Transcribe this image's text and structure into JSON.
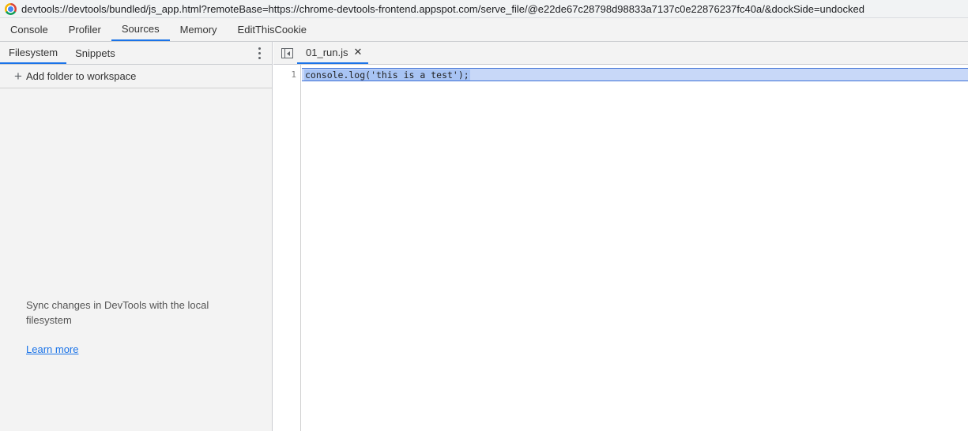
{
  "titlebar": {
    "url": "devtools://devtools/bundled/js_app.html?remoteBase=https://chrome-devtools-frontend.appspot.com/serve_file/@e22de67c28798d98833a7137c0e22876237fc40a/&dockSide=undocked"
  },
  "top_tabs": [
    {
      "label": "Console",
      "active": false
    },
    {
      "label": "Profiler",
      "active": false
    },
    {
      "label": "Sources",
      "active": true
    },
    {
      "label": "Memory",
      "active": false
    },
    {
      "label": "EditThisCookie",
      "active": false
    }
  ],
  "navigator": {
    "tabs": [
      {
        "label": "Filesystem",
        "active": true
      },
      {
        "label": "Snippets",
        "active": false
      }
    ],
    "more_icon": "vertical-ellipsis-icon",
    "add_folder_label": "Add folder to workspace",
    "add_icon": "plus-icon",
    "sync_message": "Sync changes in DevTools with the local filesystem",
    "learn_more": "Learn more"
  },
  "editor": {
    "toggle_icon": "toggle-navigator-icon",
    "open_file": "01_run.js",
    "close_icon": "close-icon",
    "lines": [
      {
        "number": "1",
        "text": "console.log('this is a test');"
      }
    ]
  },
  "colors": {
    "accent": "#1a73e8",
    "selection": "#a8c4f4",
    "panel_bg": "#f3f3f3"
  }
}
